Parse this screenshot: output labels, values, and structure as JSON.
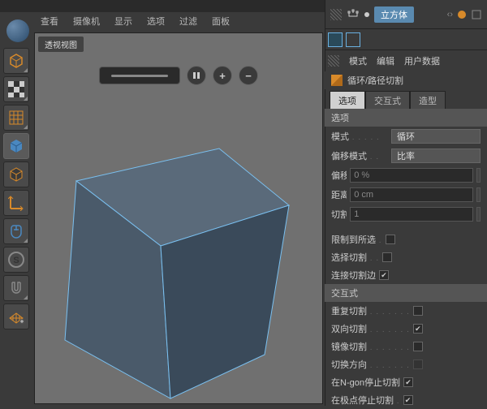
{
  "top_strip_icons": [
    "orange",
    "orange",
    "orange",
    "orange",
    "gray",
    "gray"
  ],
  "viewport_menu": [
    "查看",
    "摄像机",
    "显示",
    "选项",
    "过滤",
    "面板"
  ],
  "viewport_label": "透视视图",
  "vp_controls": {
    "pause": "⏸",
    "plus": "+",
    "minus": "−"
  },
  "object": {
    "name": "立方体"
  },
  "attr_menu": [
    "模式",
    "编辑",
    "用户数据"
  ],
  "attr_title": "循环/路径切割",
  "sub_tabs": [
    "选项",
    "交互式",
    "造型"
  ],
  "sections": {
    "options": "选项",
    "interactive": "交互式"
  },
  "props": {
    "mode": {
      "label": "模式",
      "value": "循环"
    },
    "offset_mode": {
      "label": "偏移模式",
      "value": "比率"
    },
    "offset": {
      "label": "偏移",
      "value": "0 %"
    },
    "distance": {
      "label": "距离",
      "value": "0 cm"
    },
    "cuts": {
      "label": "切割数量",
      "value": "1"
    },
    "limit_sel": {
      "label": "限制到所选",
      "checked": false
    },
    "select_cut": {
      "label": "选择切割",
      "checked": false
    },
    "connect_edges": {
      "label": "连接切割边",
      "checked": true
    },
    "repeat_cut": {
      "label": "重复切割",
      "checked": false
    },
    "bidir_cut": {
      "label": "双向切割",
      "checked": true
    },
    "mirror_cut": {
      "label": "镜像切割",
      "checked": false
    },
    "switch_dir": {
      "label": "切换方向",
      "checked": false
    },
    "ngon_stop": {
      "label": "在N-gon停止切割",
      "checked": true
    },
    "pole_stop": {
      "label": "在极点停止切割",
      "checked": true
    }
  }
}
